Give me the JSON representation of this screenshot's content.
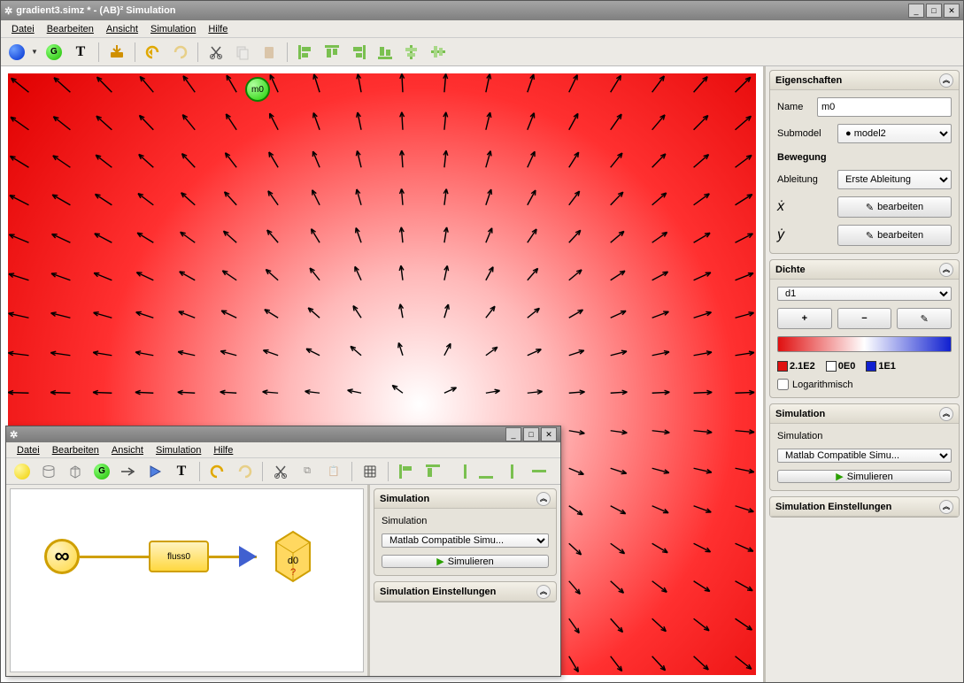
{
  "window_title": "gradient3.simz * - (AB)² Simulation",
  "menu": {
    "file": "Datei",
    "edit": "Bearbeiten",
    "view": "Ansicht",
    "simulation": "Simulation",
    "help": "Hilfe"
  },
  "toolbar": {
    "text_tool": "T"
  },
  "canvas": {
    "node_label": "m0"
  },
  "properties": {
    "title": "Eigenschaften",
    "name_label": "Name",
    "name_value": "m0",
    "submodel_label": "Submodel",
    "submodel_value": "model2",
    "movement_title": "Bewegung",
    "derivative_label": "Ableitung",
    "derivative_value": "Erste Ableitung",
    "x_label": "ẋ",
    "y_label": "ẏ",
    "edit_btn": "bearbeiten"
  },
  "density": {
    "title": "Dichte",
    "select_value": "d1",
    "legend_red": "2.1E2",
    "legend_white": "0E0",
    "legend_blue": "1E1",
    "log_label": "Logarithmisch"
  },
  "simulation_panel": {
    "title": "Simulation",
    "label": "Simulation",
    "select_value": "Matlab Compatible Simu...",
    "run_btn": "Simulieren",
    "settings_title": "Simulation Einstellungen"
  },
  "sub_window": {
    "menu": {
      "file": "Datei",
      "edit": "Bearbeiten",
      "view": "Ansicht",
      "simulation": "Simulation",
      "help": "Hilfe"
    },
    "flow_label": "fluss0",
    "sink_label": "d0",
    "sink_q": "?"
  }
}
